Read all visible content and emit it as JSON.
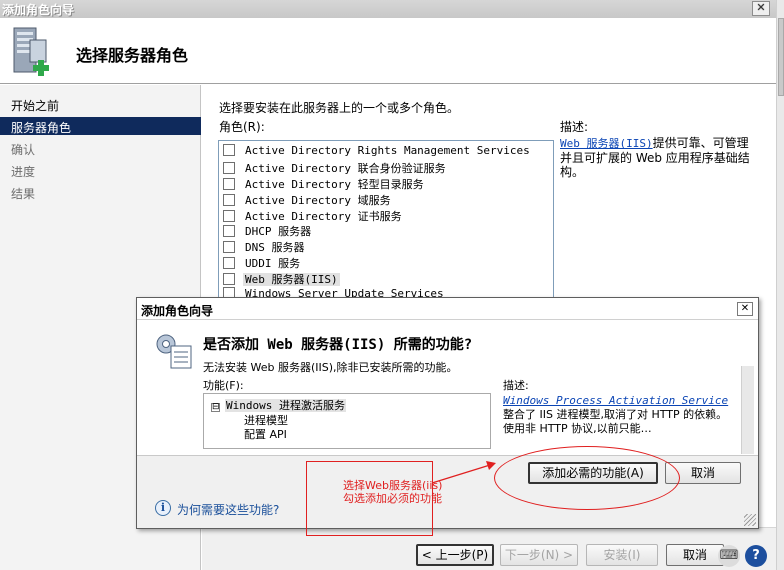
{
  "wizard": {
    "title": "添加角色向导",
    "close_glyph": "✕",
    "page_title": "选择服务器角色",
    "nav": [
      {
        "label": "开始之前",
        "state": "normal"
      },
      {
        "label": "服务器角色",
        "state": "selected"
      },
      {
        "label": "确认",
        "state": "dim"
      },
      {
        "label": "进度",
        "state": "dim"
      },
      {
        "label": "结果",
        "state": "dim"
      }
    ],
    "instruction": "选择要安装在此服务器上的一个或多个角色。",
    "roles_label": "角色(R):",
    "roles": [
      "Active Directory Rights Management Services",
      "Active Directory 联合身份验证服务",
      "Active Directory 轻型目录服务",
      "Active Directory 域服务",
      "Active Directory 证书服务",
      "DHCP 服务器",
      "DNS 服务器",
      "UDDI 服务",
      "Web 服务器(IIS)",
      "Windows Server Update Services"
    ],
    "highlighted_role": "Web 服务器(IIS)",
    "description_label": "描述:",
    "description_link": "Web 服务器(IIS)",
    "description_text": "提供可靠、可管理并且可扩展的 Web 应用程序基础结构。",
    "buttons": {
      "back": "< 上一步(P)",
      "next": "下一步(N) >",
      "install": "安装(I)",
      "cancel": "取消"
    }
  },
  "dialog": {
    "title": "添加角色向导",
    "close_glyph": "✕",
    "question": "是否添加 Web 服务器(IIS) 所需的功能?",
    "warning": "无法安装 Web 服务器(IIS),除非已安装所需的功能。",
    "features_label": "功能(F):",
    "feature_tree": {
      "expander": "⊟",
      "root": "Windows 进程激活服务",
      "children": [
        "进程模型",
        "配置 API"
      ]
    },
    "description_label": "描述:",
    "description_link": "Windows Process Activation Service",
    "description_text": "整合了 IIS 进程模型,取消了对 HTTP 的依赖。使用非 HTTP 协议,以前只能…",
    "add_button": "添加必需的功能(A)",
    "cancel_button": "取消",
    "help_glyph": "i",
    "help_link": "为何需要这些功能?"
  },
  "annotation": {
    "lines": [
      "选择Web服务器(iis)",
      "勾选添加必须的功能"
    ],
    "color": "#e02020"
  },
  "tray": [
    {
      "icon": "keyboard-icon",
      "glyph": "⌨"
    },
    {
      "icon": "help-icon",
      "glyph": "?"
    }
  ],
  "colors": {
    "selection": "#0f2a5c",
    "link": "#0a44b4",
    "annotation": "#e02020"
  }
}
